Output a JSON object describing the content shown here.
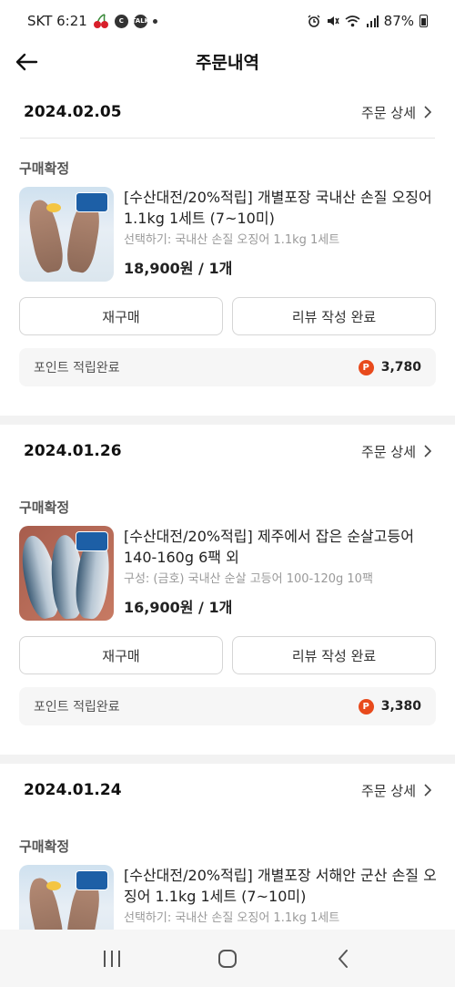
{
  "status_bar": {
    "carrier_time": "SKT 6:21",
    "talk_badge": "TALK",
    "c_badge": "C",
    "battery": "87%",
    "icons": [
      "cherry-icon",
      "c-badge-icon",
      "talk-icon",
      "dot-icon",
      "alarm-icon",
      "mute-icon",
      "wifi-icon",
      "signal-icon",
      "battery-icon"
    ]
  },
  "header": {
    "title": "주문내역",
    "back_icon": "arrow-left-icon"
  },
  "orders": [
    {
      "date": "2024.02.05",
      "detail_label": "주문 상세",
      "status": "구매확정",
      "product": {
        "title": "[수산대전/20%적립] 개별포장 국내산 손질 오징어 1.1kg 1세트 (7~10미)",
        "option": "선택하기: 국내산 손질 오징어 1.1kg 1세트",
        "price": "18,900원 / 1개"
      },
      "rebuy_label": "재구매",
      "review_label": "리뷰 작성 완료",
      "point_label": "포인트 적립완료",
      "point_icon": "P",
      "point_value": "3,780"
    },
    {
      "date": "2024.01.26",
      "detail_label": "주문 상세",
      "status": "구매확정",
      "product": {
        "title": "[수산대전/20%적립] 제주에서 잡은 순살고등어 140-160g 6팩 외",
        "option": "구성: (금호) 국내산 순살 고등어 100-120g 10팩",
        "price": "16,900원 / 1개"
      },
      "rebuy_label": "재구매",
      "review_label": "리뷰 작성 완료",
      "point_label": "포인트 적립완료",
      "point_icon": "P",
      "point_value": "3,380"
    },
    {
      "date": "2024.01.24",
      "detail_label": "주문 상세",
      "status": "구매확정",
      "product": {
        "title": "[수산대전/20%적립] 개별포장 서해안 군산 손질 오징어 1.1kg 1세트 (7~10미)",
        "option": "선택하기: 국내산 손질 오징어 1.1kg 1세트"
      }
    }
  ],
  "nav": {
    "icons": [
      "recent-apps-icon",
      "home-icon",
      "back-icon"
    ]
  }
}
